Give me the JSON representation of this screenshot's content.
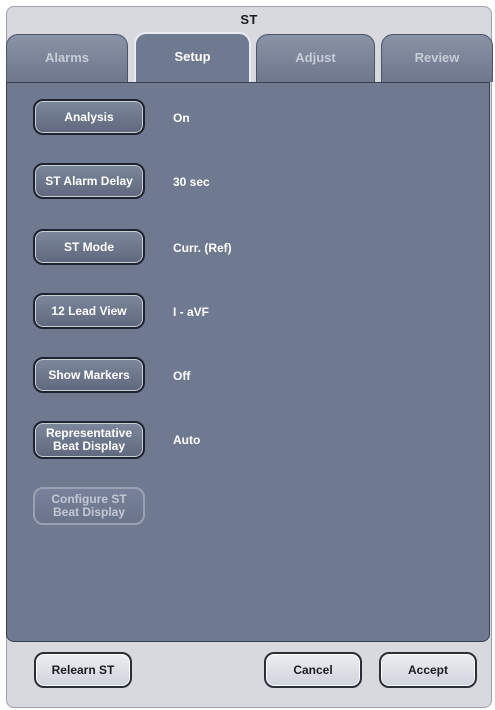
{
  "window": {
    "title": "ST"
  },
  "tabs": [
    {
      "label": "Alarms",
      "active": false
    },
    {
      "label": "Setup",
      "active": true
    },
    {
      "label": "Adjust",
      "active": false
    },
    {
      "label": "Review",
      "active": false
    }
  ],
  "settings": [
    {
      "button": "Analysis",
      "value": "On",
      "enabled": true
    },
    {
      "button": "ST Alarm Delay",
      "value": "30 sec",
      "enabled": true
    },
    {
      "button": "ST Mode",
      "value": "Curr. (Ref)",
      "enabled": true
    },
    {
      "button": "12 Lead View",
      "value": "I - aVF",
      "enabled": true
    },
    {
      "button": "Show Markers",
      "value": "Off",
      "enabled": true
    },
    {
      "button_line1": "Representative",
      "button_line2": "Beat Display",
      "value": "Auto",
      "enabled": true
    },
    {
      "button_line1": "Configure ST",
      "button_line2": "Beat Display",
      "value": "",
      "enabled": false
    }
  ],
  "footer": {
    "relearn_label": "Relearn ST",
    "cancel_label": "Cancel",
    "accept_label": "Accept"
  }
}
